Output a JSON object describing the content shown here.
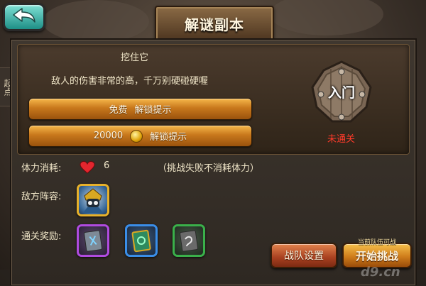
{
  "header": {
    "title": "解谜副本"
  },
  "nav": {
    "side_tab_label": "起点"
  },
  "level": {
    "name": "挖住它",
    "description": "敌人的伤害非常的高，千万别硬碰硬喔"
  },
  "hints": {
    "free_cost": "免费",
    "free_label": "解锁提示",
    "paid_cost": "20000",
    "paid_label": "解锁提示",
    "currency_icon": "gold-coin-icon"
  },
  "entrance": {
    "label": "入门",
    "status": "未通关",
    "status_color": "#ff3a2a"
  },
  "stamina": {
    "label": "体力消耗:",
    "icon": "heart-icon",
    "value": "6",
    "note": "（挑战失败不消耗体力）"
  },
  "enemy": {
    "label": "敌方阵容:",
    "icon": "enemy-hero-portrait-icon"
  },
  "rewards": {
    "label": "通关奖励:",
    "items": [
      {
        "icon": "purple-rune-book-icon",
        "color": "#b04be0"
      },
      {
        "icon": "blue-rune-book-icon",
        "color": "#3a8ee8"
      },
      {
        "icon": "green-rune-book-icon",
        "color": "#3ab04a"
      }
    ]
  },
  "actions": {
    "team_label": "战队设置",
    "start_label": "开始挑战",
    "start_caption": "当前队伍可战"
  },
  "watermark": "d9.cn"
}
